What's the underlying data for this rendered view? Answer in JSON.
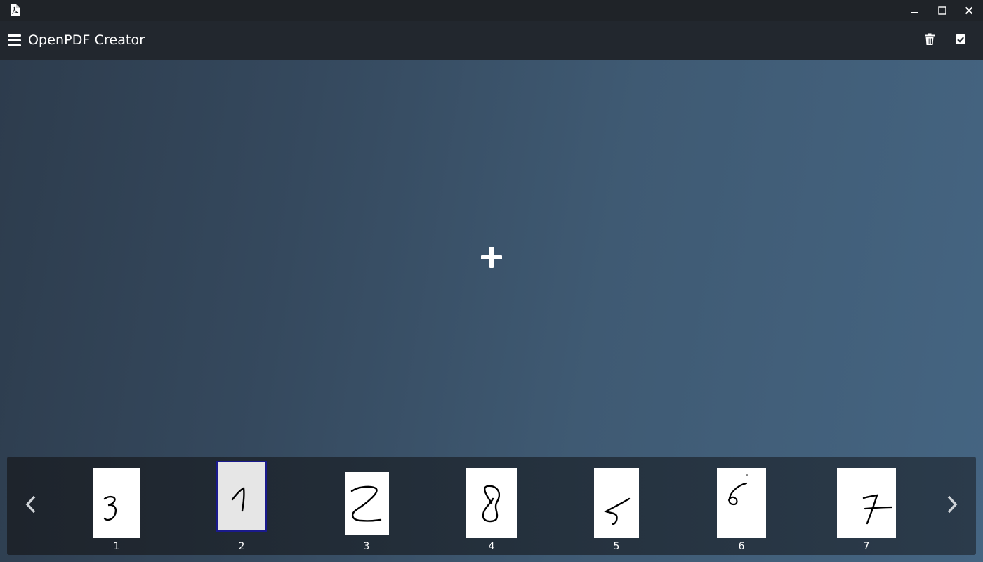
{
  "window": {
    "icon": "pdf-file-icon",
    "controls": [
      "minimize-icon",
      "maximize-icon",
      "close-icon"
    ]
  },
  "appbar": {
    "title": "OpenPDF Creator",
    "menu_icon": "hamburger-menu-icon",
    "actions": [
      "trash-icon",
      "checkbox-checked-icon"
    ]
  },
  "canvas": {
    "add_icon": "plus-icon"
  },
  "strip": {
    "prev_icon": "chevron-left-icon",
    "next_icon": "chevron-right-icon",
    "selected_page": 2,
    "pages": [
      {
        "number": "1",
        "content": "handwritten digit 3"
      },
      {
        "number": "2",
        "content": "handwritten digit 1"
      },
      {
        "number": "3",
        "content": "handwritten digit 2"
      },
      {
        "number": "4",
        "content": "handwritten digit 8"
      },
      {
        "number": "5",
        "content": "handwritten digit 5"
      },
      {
        "number": "6",
        "content": "handwritten digit 6"
      },
      {
        "number": "7",
        "content": "handwritten digit 7"
      }
    ]
  },
  "colors": {
    "titlebar": "#1f2328",
    "appbar": "#22272e",
    "canvas_start": "#2d3c4d",
    "canvas_end": "#456582",
    "selection_border": "#1a1a8c",
    "text": "#ffffff"
  }
}
